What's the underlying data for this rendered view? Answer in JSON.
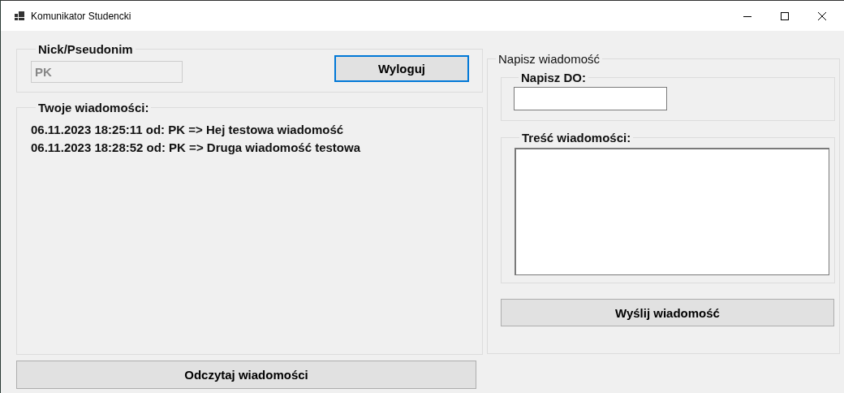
{
  "window": {
    "title": "Komunikator Studencki"
  },
  "login": {
    "legend": "Nick/Pseudonim",
    "nick": {
      "value": "PK",
      "disabled": true
    },
    "logout_button": {
      "label": "Wyloguj",
      "focused": true
    }
  },
  "messages": {
    "legend": "Twoje wiadomości:",
    "items": [
      "06.11.2023 18:25:11 od: PK => Hej testowa wiadomość",
      "06.11.2023 18:28:52 od: PK => Druga wiadomość testowa"
    ]
  },
  "read_button": {
    "label": "Odczytaj wiadomości",
    "focused": false
  },
  "compose": {
    "legend": "Napisz wiadomość",
    "to": {
      "legend": "Napisz DO:"
    },
    "body": {
      "legend": "Treść wiadomości:"
    },
    "send_button": {
      "label": "Wyślij wiadomość",
      "focused": false
    }
  }
}
